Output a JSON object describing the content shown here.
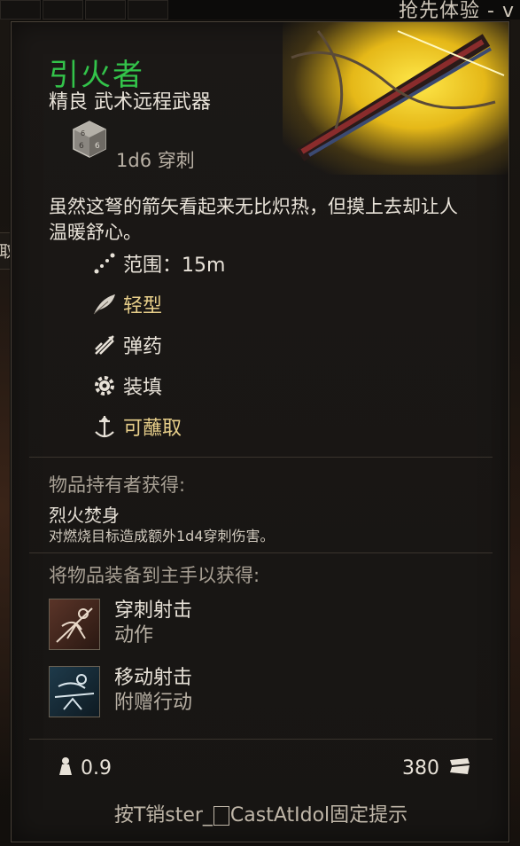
{
  "top_bar": {
    "early_access": "抢先体验 - v"
  },
  "side_tab": {
    "label": "取"
  },
  "item": {
    "name": "引火者",
    "type": "精良 武术远程武器",
    "damage": "1d6 穿刺",
    "description": "虽然这弩的箭矢看起来无比炽热，但摸上去却让人温暖舒心。",
    "properties": [
      {
        "icon": "range-icon",
        "label": "范围：15m",
        "highlight": false
      },
      {
        "icon": "feather-icon",
        "label": "轻型",
        "highlight": true
      },
      {
        "icon": "ammo-icon",
        "label": "弹药",
        "highlight": false
      },
      {
        "icon": "gear-icon",
        "label": "装填",
        "highlight": false
      },
      {
        "icon": "dip-icon",
        "label": "可蘸取",
        "highlight": true
      }
    ]
  },
  "wielder": {
    "header": "物品持有者获得:",
    "passive_name": "烈火焚身",
    "passive_desc": "对燃烧目标造成额外1d4穿刺伤害。"
  },
  "equip": {
    "header": "将物品装备到主手以获得:",
    "actions": [
      {
        "name": "穿刺射击",
        "type": "动作",
        "icon": "piercing-shot-icon"
      },
      {
        "name": "移动射击",
        "type": "附赠行动",
        "icon": "mobile-shot-icon"
      }
    ]
  },
  "footer": {
    "weight": "0.9",
    "value": "380",
    "hint_prefix": "按T销ster_",
    "hint_key": "CastAtIdol",
    "hint_suffix": "固定提示"
  },
  "colors": {
    "name": "#33c34a",
    "gold_prop": "#e8cf8a",
    "glow": "#ffe84a"
  }
}
